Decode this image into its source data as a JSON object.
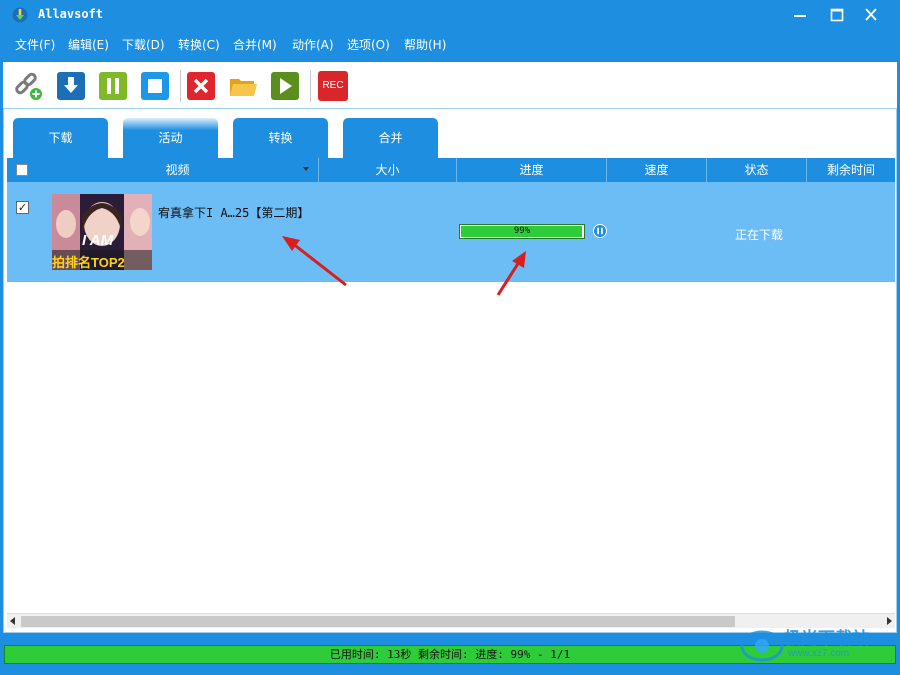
{
  "window": {
    "title": "Allavsoft"
  },
  "menu": [
    {
      "label": "文件(F)"
    },
    {
      "label": "编辑(E)"
    },
    {
      "label": "下载(D)"
    },
    {
      "label": "转换(C)"
    },
    {
      "label": "合并(M)"
    },
    {
      "label": "动作(A)"
    },
    {
      "label": "选项(O)"
    },
    {
      "label": "帮助(H)"
    }
  ],
  "toolbar": {
    "rec_label": "REC"
  },
  "tabs": [
    {
      "label": "下载"
    },
    {
      "label": "活动"
    },
    {
      "label": "转换"
    },
    {
      "label": "合并"
    }
  ],
  "table": {
    "columns": [
      "视频",
      "大小",
      "进度",
      "速度",
      "状态",
      "剩余时间"
    ],
    "rows": [
      {
        "checked": true,
        "thumbnail_text": "I AM",
        "thumbnail_caption": "拍排名TOP2",
        "title": "宥真拿下I A…25【第二期】",
        "progress_label": "99%",
        "progress_value": 0.99,
        "status": "正在下载"
      }
    ]
  },
  "statusbar": {
    "text": "已用时间: 13秒 剩余时间:  进度: 99% - 1/1",
    "progress_value": 0.99
  },
  "watermark": {
    "text": "极光下载站",
    "url": "www.xz7.com"
  },
  "colors": {
    "accent": "#1e8fe0",
    "selected_row": "#6cbcf5",
    "progress_green": "#2fcc3a",
    "annotation_red": "#d81e1e"
  }
}
